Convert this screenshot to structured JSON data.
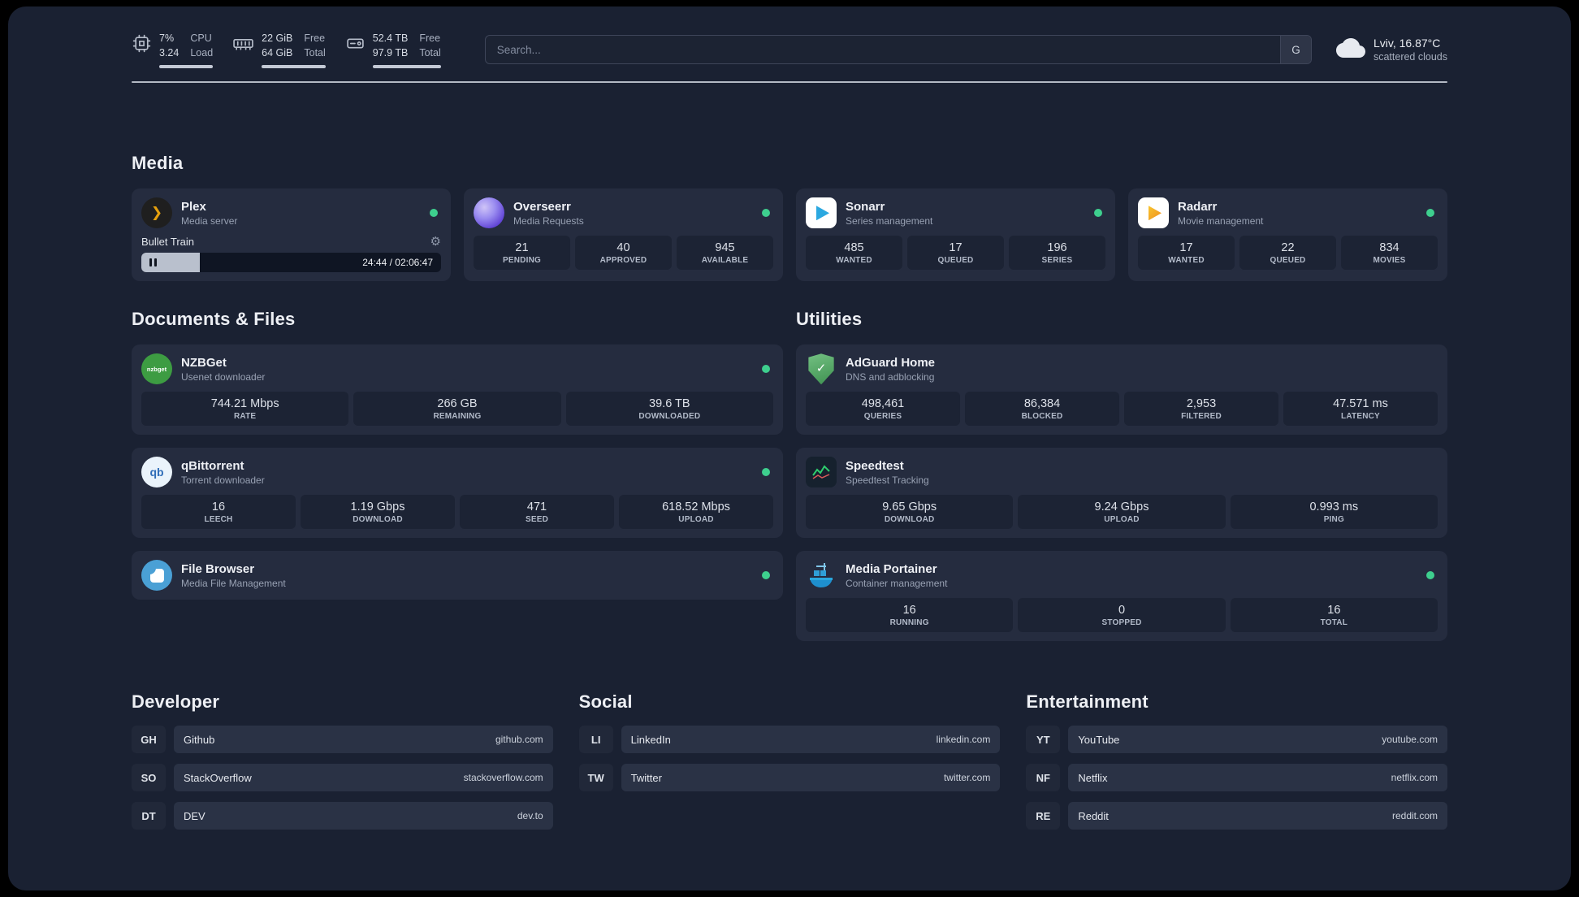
{
  "topbar": {
    "cpu": {
      "value_top": "7%",
      "value_bottom": "3.24",
      "label_top": "CPU",
      "label_bottom": "Load"
    },
    "memory": {
      "value_top": "22 GiB",
      "value_bottom": "64 GiB",
      "label_top": "Free",
      "label_bottom": "Total"
    },
    "disk": {
      "value_top": "52.4 TB",
      "value_bottom": "97.9 TB",
      "label_top": "Free",
      "label_bottom": "Total"
    },
    "search": {
      "placeholder": "Search...",
      "engine_label": "G"
    },
    "weather": {
      "location": "Lviv, 16.87°C",
      "condition": "scattered clouds"
    }
  },
  "media": {
    "title": "Media",
    "plex": {
      "name": "Plex",
      "subtitle": "Media server",
      "now_playing": "Bullet Train",
      "time": "24:44 / 02:06:47",
      "progress_percent": 19.5
    },
    "overseerr": {
      "name": "Overseerr",
      "subtitle": "Media Requests",
      "stats": [
        {
          "value": "21",
          "label": "PENDING"
        },
        {
          "value": "40",
          "label": "APPROVED"
        },
        {
          "value": "945",
          "label": "AVAILABLE"
        }
      ]
    },
    "sonarr": {
      "name": "Sonarr",
      "subtitle": "Series management",
      "stats": [
        {
          "value": "485",
          "label": "WANTED"
        },
        {
          "value": "17",
          "label": "QUEUED"
        },
        {
          "value": "196",
          "label": "SERIES"
        }
      ]
    },
    "radarr": {
      "name": "Radarr",
      "subtitle": "Movie management",
      "stats": [
        {
          "value": "17",
          "label": "WANTED"
        },
        {
          "value": "22",
          "label": "QUEUED"
        },
        {
          "value": "834",
          "label": "MOVIES"
        }
      ]
    }
  },
  "documents": {
    "title": "Documents & Files",
    "nzbget": {
      "name": "NZBGet",
      "subtitle": "Usenet downloader",
      "icon_text": "nzbget",
      "stats": [
        {
          "value": "744.21 Mbps",
          "label": "RATE"
        },
        {
          "value": "266 GB",
          "label": "REMAINING"
        },
        {
          "value": "39.6 TB",
          "label": "DOWNLOADED"
        }
      ]
    },
    "qbittorrent": {
      "name": "qBittorrent",
      "subtitle": "Torrent downloader",
      "icon_text": "qb",
      "stats": [
        {
          "value": "16",
          "label": "LEECH"
        },
        {
          "value": "1.19 Gbps",
          "label": "DOWNLOAD"
        },
        {
          "value": "471",
          "label": "SEED"
        },
        {
          "value": "618.52 Mbps",
          "label": "UPLOAD"
        }
      ]
    },
    "filebrowser": {
      "name": "File Browser",
      "subtitle": "Media File Management"
    }
  },
  "utilities": {
    "title": "Utilities",
    "adguard": {
      "name": "AdGuard Home",
      "subtitle": "DNS and adblocking",
      "stats": [
        {
          "value": "498,461",
          "label": "QUERIES"
        },
        {
          "value": "86,384",
          "label": "BLOCKED"
        },
        {
          "value": "2,953",
          "label": "FILTERED"
        },
        {
          "value": "47.571 ms",
          "label": "LATENCY"
        }
      ]
    },
    "speedtest": {
      "name": "Speedtest",
      "subtitle": "Speedtest Tracking",
      "stats": [
        {
          "value": "9.65 Gbps",
          "label": "DOWNLOAD"
        },
        {
          "value": "9.24 Gbps",
          "label": "UPLOAD"
        },
        {
          "value": "0.993 ms",
          "label": "PING"
        }
      ]
    },
    "portainer": {
      "name": "Media Portainer",
      "subtitle": "Container management",
      "stats": [
        {
          "value": "16",
          "label": "RUNNING"
        },
        {
          "value": "0",
          "label": "STOPPED"
        },
        {
          "value": "16",
          "label": "TOTAL"
        }
      ]
    }
  },
  "bookmarks": [
    {
      "title": "Developer",
      "items": [
        {
          "abbr": "GH",
          "name": "Github",
          "url": "github.com"
        },
        {
          "abbr": "SO",
          "name": "StackOverflow",
          "url": "stackoverflow.com"
        },
        {
          "abbr": "DT",
          "name": "DEV",
          "url": "dev.to"
        }
      ]
    },
    {
      "title": "Social",
      "items": [
        {
          "abbr": "LI",
          "name": "LinkedIn",
          "url": "linkedin.com"
        },
        {
          "abbr": "TW",
          "name": "Twitter",
          "url": "twitter.com"
        }
      ]
    },
    {
      "title": "Entertainment",
      "items": [
        {
          "abbr": "YT",
          "name": "YouTube",
          "url": "youtube.com"
        },
        {
          "abbr": "NF",
          "name": "Netflix",
          "url": "netflix.com"
        },
        {
          "abbr": "RE",
          "name": "Reddit",
          "url": "reddit.com"
        }
      ]
    }
  ]
}
